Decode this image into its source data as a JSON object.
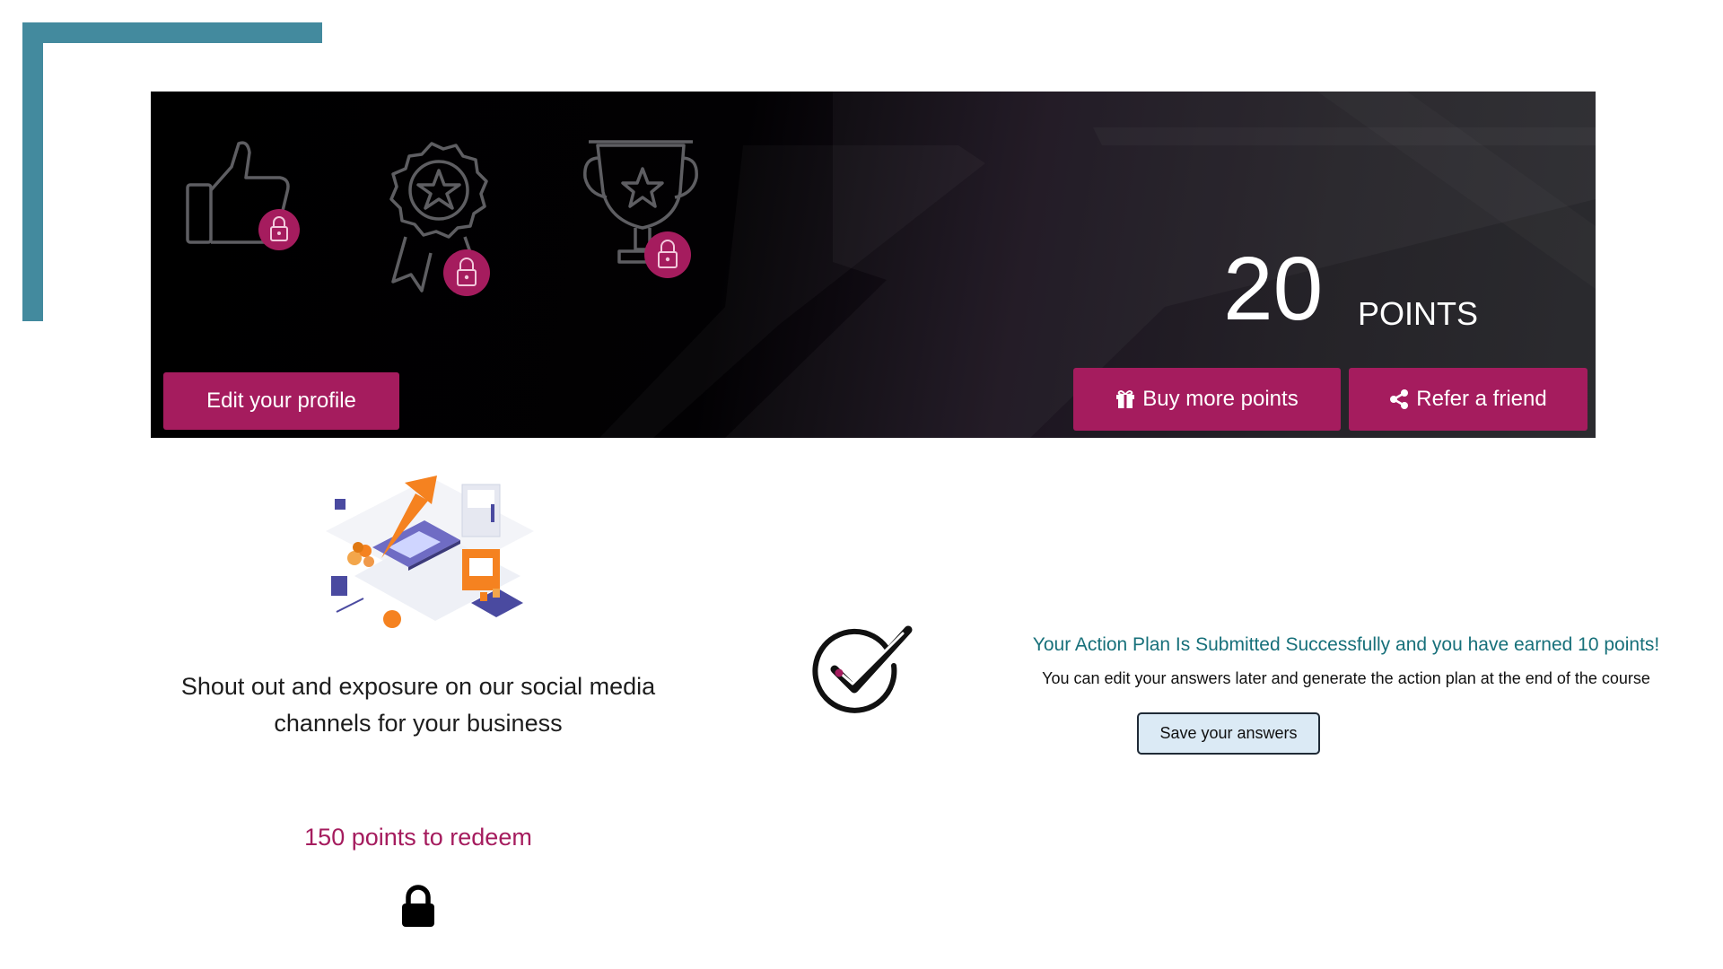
{
  "banner": {
    "points_value": "20",
    "points_label": "POINTS",
    "badges": [
      {
        "name": "thumbs-up-badge",
        "locked": true
      },
      {
        "name": "award-ribbon-badge",
        "locked": true
      },
      {
        "name": "trophy-badge",
        "locked": true
      }
    ],
    "edit_profile_label": "Edit your profile",
    "buy_points_label": "Buy more points",
    "refer_friend_label": "Refer a friend",
    "accent_color": "#a51c5e"
  },
  "reward": {
    "description": "Shout out and exposure on our social media channels for your business",
    "points_to_redeem": "150 points to redeem",
    "locked": true
  },
  "action_plan": {
    "success_title": "Your Action Plan Is Submitted Successfully and you have earned 10 points!",
    "success_subtitle": "You can edit your answers later and generate the action plan at the end of the course",
    "save_button_label": "Save your answers"
  },
  "icons": [
    "thumbs-up-icon",
    "award-icon",
    "trophy-icon",
    "padlock-icon",
    "gift-icon",
    "share-icon",
    "check-circle-icon",
    "lock-icon"
  ],
  "colors": {
    "corner": "#438a9e",
    "accent": "#a51c5e",
    "success_text": "#17707a",
    "save_button_bg": "#dbeaf5"
  }
}
